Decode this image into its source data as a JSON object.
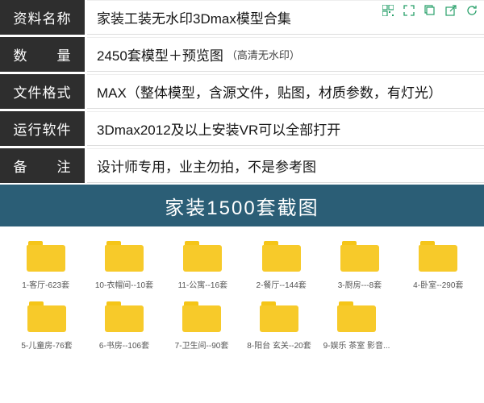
{
  "info": {
    "rows": [
      {
        "label": "资料名称",
        "value": "家装工装无水印3Dmax模型合集",
        "note": ""
      },
      {
        "label": "数　　量",
        "value": "2450套模型＋预览图",
        "note": "（高清无水印）"
      },
      {
        "label": "文件格式",
        "value": "MAX（整体模型，含源文件，贴图，材质参数，有灯光）",
        "note": ""
      },
      {
        "label": "运行软件",
        "value": "3Dmax2012及以上安装VR可以全部打开",
        "note": ""
      },
      {
        "label": "备　　注",
        "value": "设计师专用，业主勿拍，不是参考图",
        "note": ""
      }
    ]
  },
  "banner": "家装1500套截图",
  "folders_row1": [
    {
      "label": "1-客厅-623套"
    },
    {
      "label": "10-衣帽间--10套"
    },
    {
      "label": "11-公寓--16套"
    },
    {
      "label": "2-餐厅--144套"
    },
    {
      "label": "3-厨房---8套"
    },
    {
      "label": "4-卧室--290套"
    }
  ],
  "folders_row2": [
    {
      "label": "5-儿童房-76套"
    },
    {
      "label": "6-书房--106套"
    },
    {
      "label": "7-卫生间--90套"
    },
    {
      "label": "8-阳台 玄关--20套"
    },
    {
      "label": "9-娱乐 茶室 影音..."
    }
  ]
}
